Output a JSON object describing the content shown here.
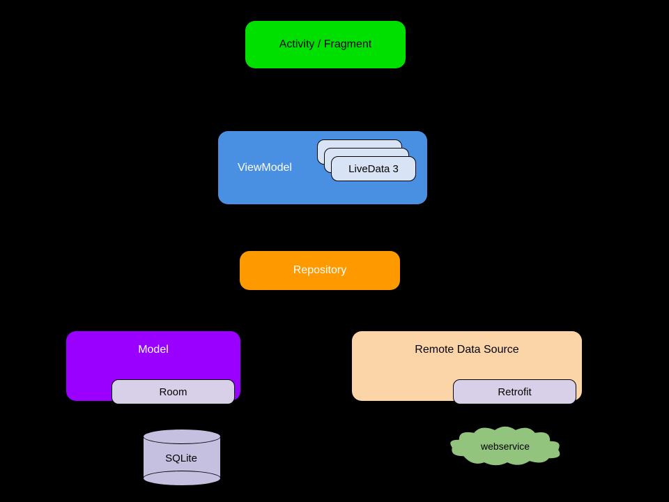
{
  "nodes": {
    "activity": "Activity / Fragment",
    "viewmodel": "ViewModel",
    "livedata": "LiveData 3",
    "repository": "Repository",
    "model": "Model",
    "room": "Room",
    "remote": "Remote Data Source",
    "retrofit": "Retrofit",
    "sqlite": "SQLite",
    "webservice": "webservice"
  },
  "colors": {
    "activity": "#00e000",
    "viewmodel": "#4a90e2",
    "livedata": "#d8e4f5",
    "repository": "#ff9900",
    "model": "#9900ff",
    "sub": "#d8d0e8",
    "remote": "#fbd5a8",
    "cylinder": "#c5bfe0",
    "cloud": "#93c47d"
  },
  "edges": [
    {
      "from": "activity",
      "to": "viewmodel"
    },
    {
      "from": "viewmodel",
      "to": "repository"
    },
    {
      "from": "repository",
      "to": "model"
    },
    {
      "from": "repository",
      "to": "remote"
    },
    {
      "from": "room",
      "to": "sqlite"
    },
    {
      "from": "retrofit",
      "to": "webservice"
    }
  ]
}
